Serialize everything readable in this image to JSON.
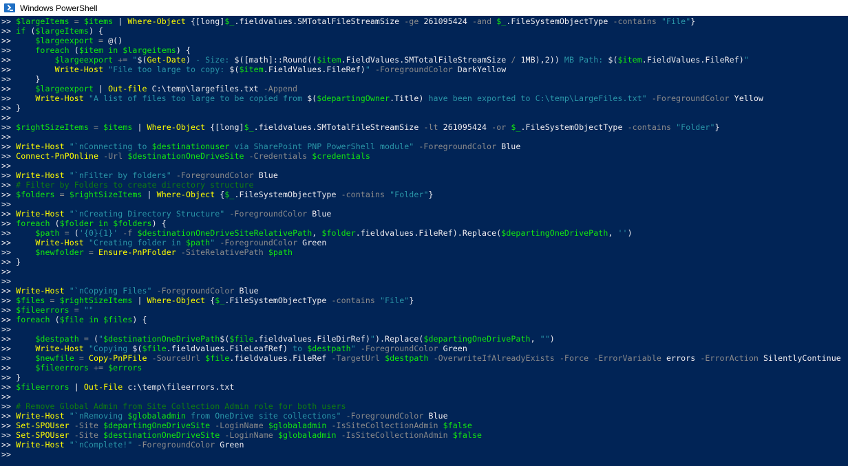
{
  "window": {
    "title": "Windows PowerShell",
    "icon": "powershell-icon"
  },
  "console": {
    "prompt": ">> ",
    "background": "#012456",
    "lines": [
      [
        [
          "v",
          "$largeItems"
        ],
        [
          "p",
          " = "
        ],
        [
          "v",
          "$items"
        ],
        [
          "w",
          " | "
        ],
        [
          "c",
          "Where-Object"
        ],
        [
          "w",
          " {[long]"
        ],
        [
          "v",
          "$_"
        ],
        [
          "w",
          ".fieldvalues.SMTotalFileStreamSize "
        ],
        [
          "p",
          "-ge"
        ],
        [
          "w",
          " 261095424 "
        ],
        [
          "p",
          "-and"
        ],
        [
          "w",
          " "
        ],
        [
          "v",
          "$_"
        ],
        [
          "w",
          ".FileSystemObjectType "
        ],
        [
          "p",
          "-contains"
        ],
        [
          "w",
          " "
        ],
        [
          "s",
          "\"File\""
        ],
        [
          "w",
          "}"
        ]
      ],
      [
        [
          "k",
          "if"
        ],
        [
          "w",
          " ("
        ],
        [
          "v",
          "$largeItems"
        ],
        [
          "w",
          ") {"
        ]
      ],
      [
        [
          "w",
          "    "
        ],
        [
          "v",
          "$largeexport"
        ],
        [
          "p",
          " = "
        ],
        [
          "w",
          "@()"
        ]
      ],
      [
        [
          "w",
          "    "
        ],
        [
          "k",
          "foreach"
        ],
        [
          "w",
          " ("
        ],
        [
          "v",
          "$item"
        ],
        [
          "k",
          " in "
        ],
        [
          "v",
          "$largeitems"
        ],
        [
          "w",
          ") {"
        ]
      ],
      [
        [
          "w",
          "        "
        ],
        [
          "v",
          "$largeexport"
        ],
        [
          "p",
          " += "
        ],
        [
          "s",
          "\""
        ],
        [
          "w",
          "$("
        ],
        [
          "c",
          "Get-Date"
        ],
        [
          "w",
          ")"
        ],
        [
          "s",
          " - Size: "
        ],
        [
          "w",
          "$([math]::Round(("
        ],
        [
          "v",
          "$item"
        ],
        [
          "w",
          ".FieldValues.SMTotalFileStreamSize "
        ],
        [
          "p",
          "/"
        ],
        [
          "w",
          " 1MB),2))"
        ],
        [
          "s",
          " MB Path: "
        ],
        [
          "w",
          "$("
        ],
        [
          "v",
          "$item"
        ],
        [
          "w",
          ".FieldValues.FileRef)"
        ],
        [
          "s",
          "\""
        ]
      ],
      [
        [
          "w",
          "        "
        ],
        [
          "c",
          "Write-Host"
        ],
        [
          "s",
          " \"File too large to copy: "
        ],
        [
          "w",
          "$("
        ],
        [
          "v",
          "$item"
        ],
        [
          "w",
          ".FieldValues.FileRef)"
        ],
        [
          "s",
          "\""
        ],
        [
          "p",
          " -ForegroundColor"
        ],
        [
          "w",
          " DarkYellow"
        ]
      ],
      [
        [
          "w",
          "    }"
        ]
      ],
      [
        [
          "w",
          "    "
        ],
        [
          "v",
          "$largeexport"
        ],
        [
          "w",
          " | "
        ],
        [
          "c",
          "Out-file"
        ],
        [
          "w",
          " C:\\temp\\largefiles.txt "
        ],
        [
          "p",
          "-Append"
        ]
      ],
      [
        [
          "w",
          "    "
        ],
        [
          "c",
          "Write-Host"
        ],
        [
          "s",
          " \"A list of files too large to be copied from "
        ],
        [
          "w",
          "$("
        ],
        [
          "v",
          "$departingOwner"
        ],
        [
          "w",
          ".Title)"
        ],
        [
          "s",
          " have been exported to C:\\temp\\LargeFiles.txt\""
        ],
        [
          "p",
          " -ForegroundColor"
        ],
        [
          "w",
          " Yellow"
        ]
      ],
      [
        [
          "w",
          "}"
        ]
      ],
      [],
      [
        [
          "v",
          "$rightSizeItems"
        ],
        [
          "p",
          " = "
        ],
        [
          "v",
          "$items"
        ],
        [
          "w",
          " | "
        ],
        [
          "c",
          "Where-Object"
        ],
        [
          "w",
          " {[long]"
        ],
        [
          "v",
          "$_"
        ],
        [
          "w",
          ".fieldvalues.SMTotalFileStreamSize "
        ],
        [
          "p",
          "-lt"
        ],
        [
          "w",
          " 261095424 "
        ],
        [
          "p",
          "-or"
        ],
        [
          "w",
          " "
        ],
        [
          "v",
          "$_"
        ],
        [
          "w",
          ".FileSystemObjectType "
        ],
        [
          "p",
          "-contains"
        ],
        [
          "w",
          " "
        ],
        [
          "s",
          "\"Folder\""
        ],
        [
          "w",
          "}"
        ]
      ],
      [],
      [
        [
          "c",
          "Write-Host"
        ],
        [
          "s",
          " \"`nConnecting to "
        ],
        [
          "v",
          "$destinationuser"
        ],
        [
          "s",
          " via SharePoint PNP PowerShell module\""
        ],
        [
          "p",
          " -ForegroundColor"
        ],
        [
          "w",
          " Blue"
        ]
      ],
      [
        [
          "c",
          "Connect-PnPOnline"
        ],
        [
          "p",
          " -Url"
        ],
        [
          "w",
          " "
        ],
        [
          "v",
          "$destinationOneDriveSite"
        ],
        [
          "p",
          " -Credentials"
        ],
        [
          "w",
          " "
        ],
        [
          "v",
          "$credentials"
        ]
      ],
      [],
      [
        [
          "c",
          "Write-Host"
        ],
        [
          "s",
          " \"`nFilter by folders\""
        ],
        [
          "p",
          " -ForegroundColor"
        ],
        [
          "w",
          " Blue"
        ]
      ],
      [
        [
          "cm",
          "# Filter by Folders to create directory structure"
        ]
      ],
      [
        [
          "v",
          "$folders"
        ],
        [
          "p",
          " = "
        ],
        [
          "v",
          "$rightSizeItems"
        ],
        [
          "w",
          " | "
        ],
        [
          "c",
          "Where-Object"
        ],
        [
          "w",
          " {"
        ],
        [
          "v",
          "$_"
        ],
        [
          "w",
          ".FileSystemObjectType "
        ],
        [
          "p",
          "-contains"
        ],
        [
          "w",
          " "
        ],
        [
          "s",
          "\"Folder\""
        ],
        [
          "w",
          "}"
        ]
      ],
      [],
      [
        [
          "c",
          "Write-Host"
        ],
        [
          "s",
          " \"`nCreating Directory Structure\""
        ],
        [
          "p",
          " -ForegroundColor"
        ],
        [
          "w",
          " Blue"
        ]
      ],
      [
        [
          "k",
          "foreach"
        ],
        [
          "w",
          " ("
        ],
        [
          "v",
          "$folder"
        ],
        [
          "k",
          " in "
        ],
        [
          "v",
          "$folders"
        ],
        [
          "w",
          ") {"
        ]
      ],
      [
        [
          "w",
          "    "
        ],
        [
          "v",
          "$path"
        ],
        [
          "p",
          " = "
        ],
        [
          "w",
          "("
        ],
        [
          "s",
          "'{0}{1}'"
        ],
        [
          "p",
          " -f"
        ],
        [
          "w",
          " "
        ],
        [
          "v",
          "$destinationOneDriveSiteRelativePath"
        ],
        [
          "w",
          ", "
        ],
        [
          "v",
          "$folder"
        ],
        [
          "w",
          ".fieldvalues.FileRef).Replace("
        ],
        [
          "v",
          "$departingOneDrivePath"
        ],
        [
          "w",
          ", "
        ],
        [
          "s",
          "''"
        ],
        [
          "w",
          ")"
        ]
      ],
      [
        [
          "w",
          "    "
        ],
        [
          "c",
          "Write-Host"
        ],
        [
          "s",
          " \"Creating folder in "
        ],
        [
          "v",
          "$path"
        ],
        [
          "s",
          "\""
        ],
        [
          "p",
          " -ForegroundColor"
        ],
        [
          "w",
          " Green"
        ]
      ],
      [
        [
          "w",
          "    "
        ],
        [
          "v",
          "$newfolder"
        ],
        [
          "p",
          " = "
        ],
        [
          "c",
          "Ensure-PnPFolder"
        ],
        [
          "p",
          " -SiteRelativePath"
        ],
        [
          "w",
          " "
        ],
        [
          "v",
          "$path"
        ]
      ],
      [
        [
          "w",
          "}"
        ]
      ],
      [],
      [],
      [
        [
          "c",
          "Write-Host"
        ],
        [
          "s",
          " \"`nCopying Files\""
        ],
        [
          "p",
          " -ForegroundColor"
        ],
        [
          "w",
          " Blue"
        ]
      ],
      [
        [
          "v",
          "$files"
        ],
        [
          "p",
          " = "
        ],
        [
          "v",
          "$rightSizeItems"
        ],
        [
          "w",
          " | "
        ],
        [
          "c",
          "Where-Object"
        ],
        [
          "w",
          " {"
        ],
        [
          "v",
          "$_"
        ],
        [
          "w",
          ".FileSystemObjectType "
        ],
        [
          "p",
          "-contains"
        ],
        [
          "w",
          " "
        ],
        [
          "s",
          "\"File\""
        ],
        [
          "w",
          "}"
        ]
      ],
      [
        [
          "v",
          "$fileerrors"
        ],
        [
          "p",
          " = "
        ],
        [
          "s",
          "\"\""
        ]
      ],
      [
        [
          "k",
          "foreach"
        ],
        [
          "w",
          " ("
        ],
        [
          "v",
          "$file"
        ],
        [
          "k",
          " in "
        ],
        [
          "v",
          "$files"
        ],
        [
          "w",
          ") {"
        ]
      ],
      [],
      [
        [
          "w",
          "    "
        ],
        [
          "v",
          "$destpath"
        ],
        [
          "p",
          " = "
        ],
        [
          "w",
          "("
        ],
        [
          "s",
          "\""
        ],
        [
          "v",
          "$destinationOneDrivePath"
        ],
        [
          "w",
          "$("
        ],
        [
          "v",
          "$file"
        ],
        [
          "w",
          ".fieldvalues.FileDirRef)"
        ],
        [
          "s",
          "\""
        ],
        [
          "w",
          ").Replace("
        ],
        [
          "v",
          "$departingOneDrivePath"
        ],
        [
          "w",
          ", "
        ],
        [
          "s",
          "\"\""
        ],
        [
          "w",
          ")"
        ]
      ],
      [
        [
          "w",
          "    "
        ],
        [
          "c",
          "Write-Host"
        ],
        [
          "s",
          " \"Copying "
        ],
        [
          "w",
          "$("
        ],
        [
          "v",
          "$file"
        ],
        [
          "w",
          ".fieldvalues.FileLeafRef)"
        ],
        [
          "s",
          " to "
        ],
        [
          "v",
          "$destpath"
        ],
        [
          "s",
          "\""
        ],
        [
          "p",
          " -ForegroundColor"
        ],
        [
          "w",
          " Green"
        ]
      ],
      [
        [
          "w",
          "    "
        ],
        [
          "v",
          "$newfile"
        ],
        [
          "p",
          " = "
        ],
        [
          "c",
          "Copy-PnPFile"
        ],
        [
          "p",
          " -SourceUrl"
        ],
        [
          "w",
          " "
        ],
        [
          "v",
          "$file"
        ],
        [
          "w",
          ".fieldvalues.FileRef "
        ],
        [
          "p",
          "-TargetUrl"
        ],
        [
          "w",
          " "
        ],
        [
          "v",
          "$destpath"
        ],
        [
          "p",
          " -OverwriteIfAlreadyExists -Force -ErrorVariable"
        ],
        [
          "w",
          " errors "
        ],
        [
          "p",
          "-ErrorAction"
        ],
        [
          "w",
          " SilentlyContinue"
        ]
      ],
      [
        [
          "w",
          "    "
        ],
        [
          "v",
          "$fileerrors"
        ],
        [
          "p",
          " += "
        ],
        [
          "v",
          "$errors"
        ]
      ],
      [
        [
          "w",
          "}"
        ]
      ],
      [
        [
          "v",
          "$fileerrors"
        ],
        [
          "w",
          " | "
        ],
        [
          "c",
          "Out-File"
        ],
        [
          "w",
          " c:\\temp\\fileerrors.txt"
        ]
      ],
      [],
      [
        [
          "cm",
          "# Remove Global Admin from Site Collection Admin role for both users"
        ]
      ],
      [
        [
          "c",
          "Write-Host"
        ],
        [
          "s",
          " \"`nRemoving "
        ],
        [
          "v",
          "$globaladmin"
        ],
        [
          "s",
          " from OneDrive site collections\""
        ],
        [
          "p",
          " -ForegroundColor"
        ],
        [
          "w",
          " Blue"
        ]
      ],
      [
        [
          "c",
          "Set-SPOUser"
        ],
        [
          "p",
          " -Site"
        ],
        [
          "w",
          " "
        ],
        [
          "v",
          "$departingOneDriveSite"
        ],
        [
          "p",
          " -LoginName"
        ],
        [
          "w",
          " "
        ],
        [
          "v",
          "$globaladmin"
        ],
        [
          "p",
          " -IsSiteCollectionAdmin"
        ],
        [
          "w",
          " "
        ],
        [
          "v",
          "$false"
        ]
      ],
      [
        [
          "c",
          "Set-SPOUser"
        ],
        [
          "p",
          " -Site"
        ],
        [
          "w",
          " "
        ],
        [
          "v",
          "$destinationOneDriveSite"
        ],
        [
          "p",
          " -LoginName"
        ],
        [
          "w",
          " "
        ],
        [
          "v",
          "$globaladmin"
        ],
        [
          "p",
          " -IsSiteCollectionAdmin"
        ],
        [
          "w",
          " "
        ],
        [
          "v",
          "$false"
        ]
      ],
      [
        [
          "c",
          "Write-Host"
        ],
        [
          "s",
          " \"`nComplete!\""
        ],
        [
          "p",
          " -ForegroundColor"
        ],
        [
          "w",
          " Green"
        ]
      ],
      []
    ]
  }
}
